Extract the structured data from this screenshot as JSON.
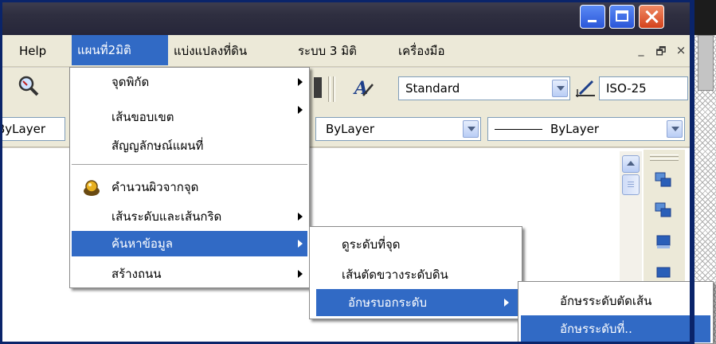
{
  "menubar": {
    "items": [
      {
        "label": "Help"
      },
      {
        "label": "แผนที่2มิติ"
      },
      {
        "label": "แบ่งแปลงที่ดิน"
      },
      {
        "label": "ระบบ 3 มิติ"
      },
      {
        "label": "เครื่องมือ"
      }
    ],
    "mdi_min": "_",
    "mdi_restore": "🗗",
    "mdi_close": "×"
  },
  "toolbar": {
    "text_style": "Standard",
    "dim_style": "ISO-25"
  },
  "properties": {
    "layer": "ByLayer",
    "color": "ByLayer",
    "linetype": "ByLayer"
  },
  "menu_map2d": {
    "items": [
      {
        "label": "จุดพิกัด"
      },
      {
        "label": "เส้นขอบเขต"
      },
      {
        "label": "สัญญลักษณ์แผนที่"
      },
      {
        "label": "คำนวนผิวจากจุด"
      },
      {
        "label": "เส้นระดับและเส้นกริด"
      },
      {
        "label": "ค้นหาข้อมูล"
      },
      {
        "label": "สร้างถนน"
      }
    ]
  },
  "menu_search": {
    "items": [
      {
        "label": "ดูระดับที่จุด"
      },
      {
        "label": "เส้นตัดขวางระดับดิน"
      },
      {
        "label": "อักษรบอกระดับ"
      }
    ]
  },
  "menu_label": {
    "items": [
      {
        "label": "อักษรระดับตัดเส้น"
      },
      {
        "label": "อักษรระดับที่.."
      }
    ]
  },
  "colors": {
    "highlight": "#316ac5",
    "menubar_bg": "#ece9d8",
    "titlebar": "#2f2f40",
    "frame": "#0a246a"
  },
  "icons": [
    "minimize-icon",
    "maximize-icon",
    "close-icon",
    "magnifier-icon",
    "text-style-icon",
    "dim-style-icon",
    "calculator-icon",
    "arrange-icon"
  ]
}
